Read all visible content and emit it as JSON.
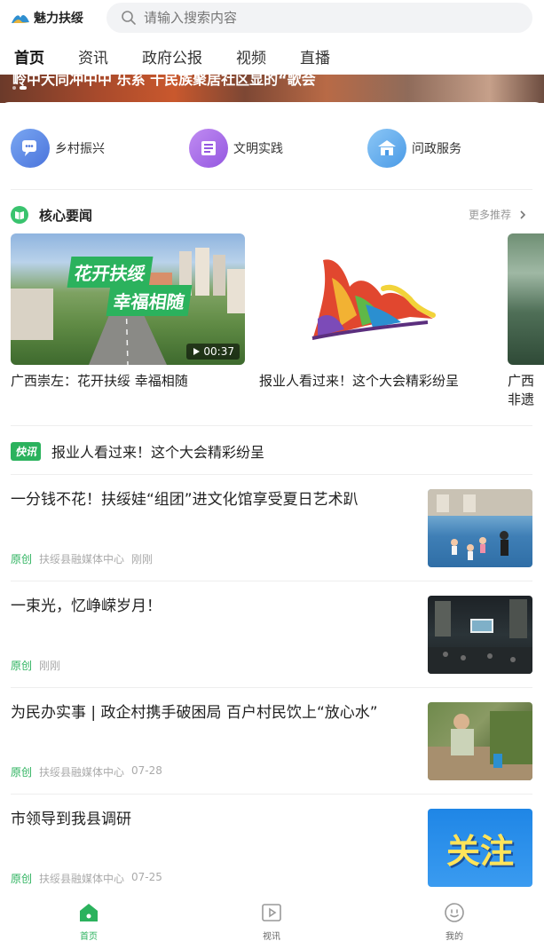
{
  "header": {
    "logo_text": "魅力扶绥",
    "search_placeholder": "请输入搜索内容"
  },
  "tabs": [
    {
      "label": "首页",
      "active": true
    },
    {
      "label": "资讯",
      "active": false
    },
    {
      "label": "政府公报",
      "active": false
    },
    {
      "label": "视频",
      "active": false
    },
    {
      "label": "直播",
      "active": false
    }
  ],
  "banner": {
    "caption": "岭中大同冲中中 乐系 十民族聚居社区显的“歌会"
  },
  "quick_entries": [
    {
      "label": "乡村振兴",
      "icon": "chat-icon",
      "color": "#5b86e5"
    },
    {
      "label": "文明实践",
      "icon": "newspaper-icon",
      "color": "#a864e8"
    },
    {
      "label": "问政服务",
      "icon": "government-icon",
      "color": "#5aa8ec"
    }
  ],
  "core_news": {
    "title": "核心要闻",
    "more": "更多推荐",
    "cards": [
      {
        "title": "广西崇左：花开扶绥 幸福相随",
        "duration": "00:37",
        "overlay_line1": "花开扶绥",
        "overlay_line2": "幸福相随"
      },
      {
        "title": "报业人看过来！这个大会精彩纷呈"
      },
      {
        "title": "广西非遗 粥，万"
      }
    ]
  },
  "flash": {
    "badge": "快讯",
    "text": "报业人看过来！这个大会精彩纷呈"
  },
  "news": [
    {
      "title": "一分钱不花！扶绥娃“组团”进文化馆享受夏日艺术趴",
      "tag": "原创",
      "source": "扶绥县融媒体中心",
      "time": "刚刚"
    },
    {
      "title": "一束光，忆峥嵘岁月！",
      "tag": "原创",
      "source": "",
      "time": "刚刚"
    },
    {
      "title": "为民办实事 | 政企村携手破困局 百户村民饮上“放心水”",
      "tag": "原创",
      "source": "扶绥县融媒体中心",
      "time": "07-28"
    },
    {
      "title": "市领导到我县调研",
      "tag": "原创",
      "source": "扶绥县融媒体中心",
      "time": "07-25",
      "thumb_text": "关注"
    }
  ],
  "bottom_nav": [
    {
      "label": "首页",
      "icon": "home-icon",
      "active": true
    },
    {
      "label": "视讯",
      "icon": "video-icon",
      "active": false
    },
    {
      "label": "我的",
      "icon": "profile-icon",
      "active": false
    }
  ],
  "colors": {
    "accent": "#2bb25d",
    "search_bg": "#f2f3f5"
  }
}
